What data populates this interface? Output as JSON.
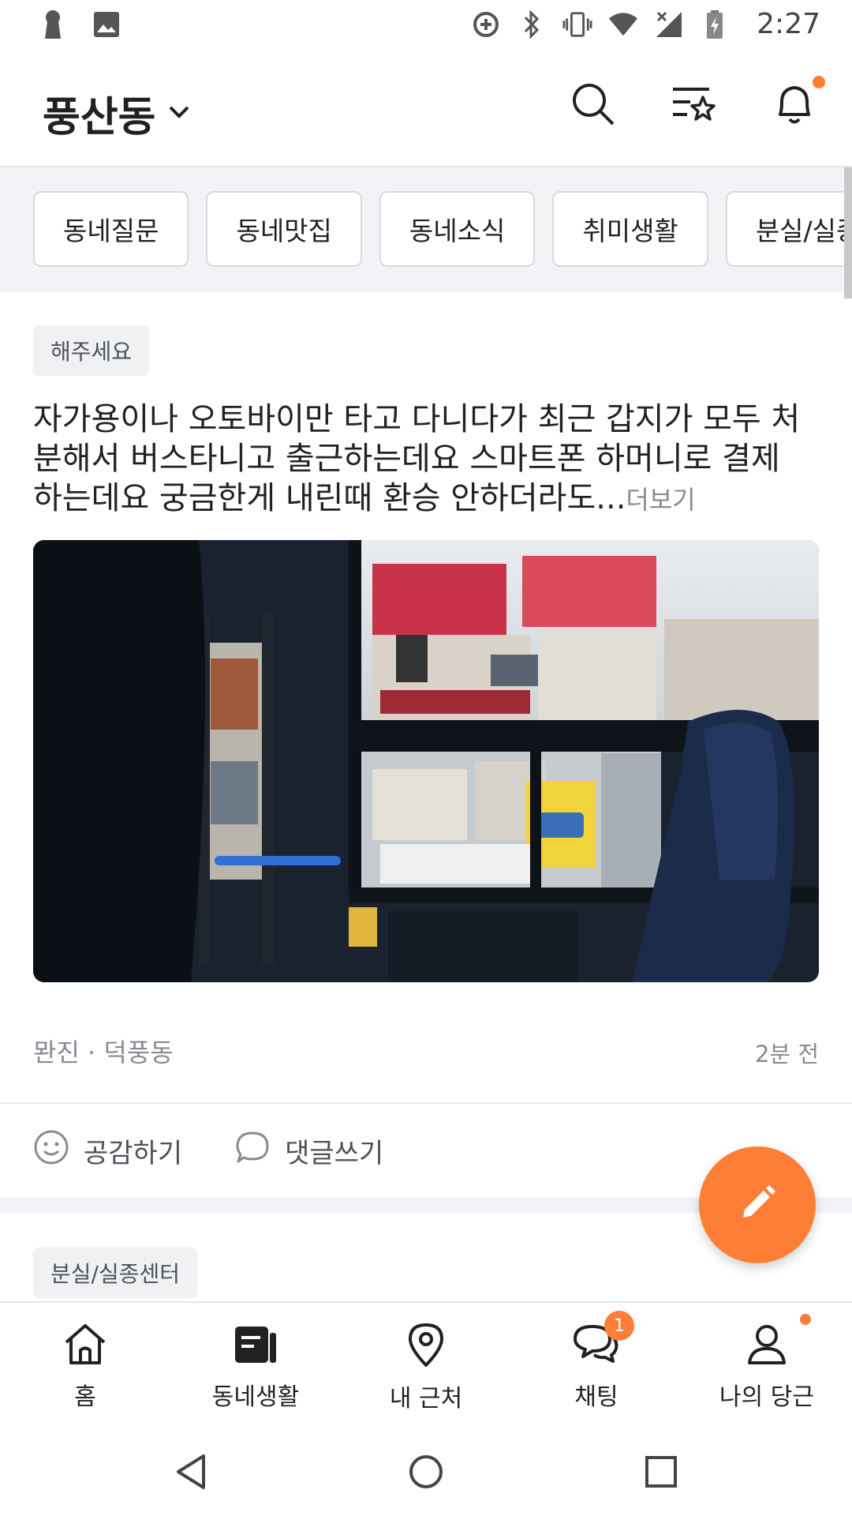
{
  "status_bar": {
    "time": "2:27",
    "left_icons": [
      "keyhole-icon",
      "image-icon"
    ],
    "right_icons": [
      "data-saver-icon",
      "bluetooth-icon",
      "vibrate-icon",
      "wifi-icon",
      "no-signal-icon",
      "battery-charging-icon"
    ]
  },
  "header": {
    "location": "풍산동",
    "actions": [
      "search-icon",
      "category-star-icon",
      "bell-icon"
    ],
    "accent_color": "#ff7e36"
  },
  "categories": [
    {
      "label": "동네질문"
    },
    {
      "label": "동네맛집"
    },
    {
      "label": "동네소식"
    },
    {
      "label": "취미생활"
    },
    {
      "label": "분실/실종"
    }
  ],
  "post": {
    "tag": "해주세요",
    "text": "자가용이나 오토바이만 타고 다니다가 최근 갑지가 모두 처분해서 버스타니고 출근하는데요 스마트폰 하머니로 결제 하는데요 궁금한게 내린때 환승 안하더라도...",
    "more": "더보기",
    "author_location": "뫈진 · 덕풍동",
    "time": "2분 전",
    "reactions": [
      {
        "label": "공감하기",
        "icon": "smile-icon"
      },
      {
        "label": "댓글쓰기",
        "icon": "comment-icon"
      }
    ]
  },
  "next_post": {
    "tag": "분실/실종센터"
  },
  "fab": {
    "icon": "pencil-icon"
  },
  "bottom_nav": [
    {
      "label": "홈",
      "icon": "home-icon"
    },
    {
      "label": "동네생활",
      "icon": "neighborhood-icon"
    },
    {
      "label": "내 근처",
      "icon": "location-pin-icon"
    },
    {
      "label": "채팅",
      "icon": "chat-icon",
      "badge": "1"
    },
    {
      "label": "나의 당근",
      "icon": "person-icon"
    }
  ],
  "system_nav": [
    "back-icon",
    "home-circle-icon",
    "recents-icon"
  ]
}
